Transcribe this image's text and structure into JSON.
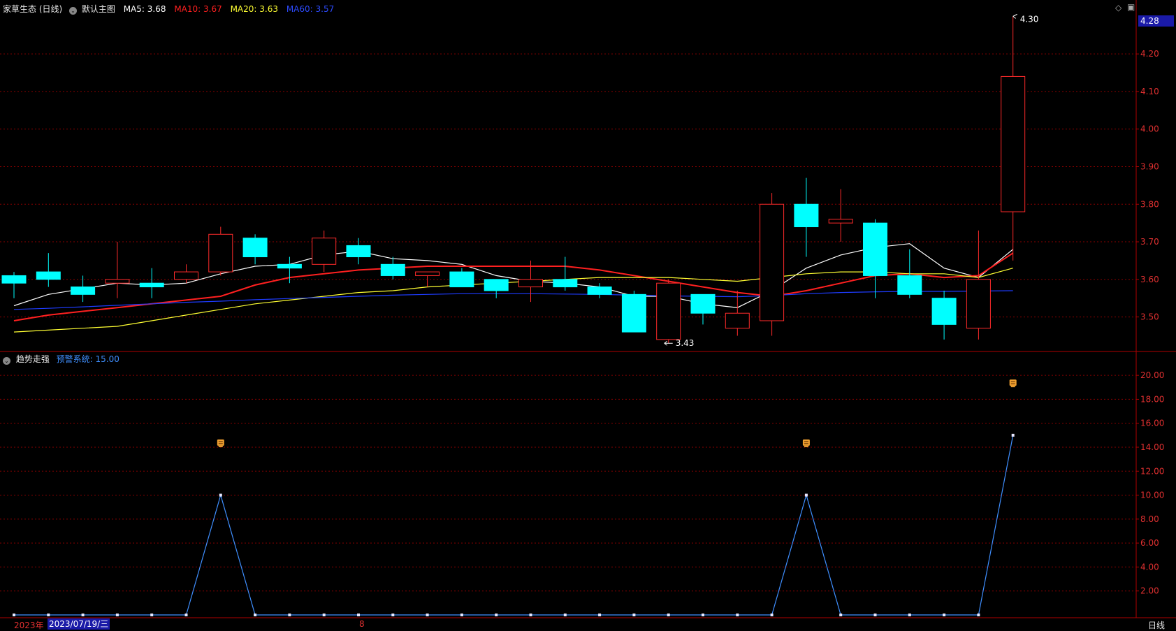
{
  "header": {
    "stock_name": "家草生态 (日线)",
    "main_chart_name": "默认主图",
    "ma5": {
      "label": "MA5:",
      "value": "3.68",
      "color": "#ffffff"
    },
    "ma10": {
      "label": "MA10:",
      "value": "3.67",
      "color": "#ff2020"
    },
    "ma20": {
      "label": "MA20:",
      "value": "3.63",
      "color": "#ffff33"
    },
    "ma60": {
      "label": "MA60:",
      "value": "3.57",
      "color": "#1e3cff"
    }
  },
  "top_right": {
    "diamond": "◇",
    "box": "▣",
    "last_price_tag": "4.28"
  },
  "indicator_header": {
    "name": "趋势走强",
    "series_label": "预警系统:",
    "series_value": "15.00"
  },
  "bottom_bar": {
    "year": "2023年",
    "date": "2023/07/19/三",
    "month_tick": "8",
    "period": "日线"
  },
  "colors": {
    "up": "#ff2b2b",
    "down": "#00ffff",
    "grid": "#8a0000",
    "axis_text": "#e03030",
    "indicator_line": "#3f8fff",
    "signal_icon": "#f0a030"
  },
  "chart_data": [
    {
      "type": "candlestick",
      "title": "",
      "ylim": [
        3.41,
        4.31
      ],
      "y_ticks": [
        3.5,
        3.6,
        3.7,
        3.8,
        3.9,
        4.0,
        4.1,
        4.2
      ],
      "y_tick_labels": [
        "3.50",
        "3.60",
        "3.70",
        "3.80",
        "3.90",
        "4.00",
        "4.10",
        "4.20"
      ],
      "annotations": {
        "high_label": "4.30",
        "low_label": "3.43"
      },
      "candles": [
        {
          "o": 3.61,
          "h": 3.62,
          "l": 3.55,
          "c": 3.59
        },
        {
          "o": 3.62,
          "h": 3.67,
          "l": 3.58,
          "c": 3.6
        },
        {
          "o": 3.58,
          "h": 3.61,
          "l": 3.54,
          "c": 3.56
        },
        {
          "o": 3.59,
          "h": 3.7,
          "l": 3.55,
          "c": 3.6
        },
        {
          "o": 3.59,
          "h": 3.63,
          "l": 3.55,
          "c": 3.58
        },
        {
          "o": 3.6,
          "h": 3.64,
          "l": 3.59,
          "c": 3.62
        },
        {
          "o": 3.62,
          "h": 3.74,
          "l": 3.61,
          "c": 3.72
        },
        {
          "o": 3.71,
          "h": 3.72,
          "l": 3.64,
          "c": 3.66
        },
        {
          "o": 3.64,
          "h": 3.66,
          "l": 3.59,
          "c": 3.63
        },
        {
          "o": 3.64,
          "h": 3.73,
          "l": 3.62,
          "c": 3.71
        },
        {
          "o": 3.69,
          "h": 3.71,
          "l": 3.64,
          "c": 3.66
        },
        {
          "o": 3.64,
          "h": 3.66,
          "l": 3.6,
          "c": 3.61
        },
        {
          "o": 3.61,
          "h": 3.62,
          "l": 3.58,
          "c": 3.62
        },
        {
          "o": 3.62,
          "h": 3.63,
          "l": 3.58,
          "c": 3.58
        },
        {
          "o": 3.6,
          "h": 3.6,
          "l": 3.55,
          "c": 3.57
        },
        {
          "o": 3.58,
          "h": 3.65,
          "l": 3.54,
          "c": 3.6
        },
        {
          "o": 3.6,
          "h": 3.66,
          "l": 3.57,
          "c": 3.58
        },
        {
          "o": 3.58,
          "h": 3.59,
          "l": 3.55,
          "c": 3.56
        },
        {
          "o": 3.56,
          "h": 3.57,
          "l": 3.46,
          "c": 3.46
        },
        {
          "o": 3.44,
          "h": 3.6,
          "l": 3.43,
          "c": 3.59
        },
        {
          "o": 3.56,
          "h": 3.56,
          "l": 3.48,
          "c": 3.51
        },
        {
          "o": 3.47,
          "h": 3.57,
          "l": 3.45,
          "c": 3.51
        },
        {
          "o": 3.49,
          "h": 3.83,
          "l": 3.45,
          "c": 3.8
        },
        {
          "o": 3.8,
          "h": 3.87,
          "l": 3.66,
          "c": 3.74
        },
        {
          "o": 3.75,
          "h": 3.84,
          "l": 3.7,
          "c": 3.76
        },
        {
          "o": 3.75,
          "h": 3.76,
          "l": 3.55,
          "c": 3.61
        },
        {
          "o": 3.61,
          "h": 3.68,
          "l": 3.55,
          "c": 3.56
        },
        {
          "o": 3.55,
          "h": 3.57,
          "l": 3.44,
          "c": 3.48
        },
        {
          "o": 3.47,
          "h": 3.73,
          "l": 3.44,
          "c": 3.6
        },
        {
          "o": 3.78,
          "h": 4.3,
          "l": 3.65,
          "c": 4.14
        }
      ],
      "series": [
        {
          "name": "MA5",
          "values": [
            3.53,
            3.56,
            3.575,
            3.59,
            3.585,
            3.59,
            3.615,
            3.635,
            3.64,
            3.665,
            3.675,
            3.655,
            3.65,
            3.64,
            3.61,
            3.595,
            3.59,
            3.58,
            3.555,
            3.555,
            3.535,
            3.525,
            3.57,
            3.63,
            3.665,
            3.685,
            3.695,
            3.63,
            3.605,
            3.68
          ]
        },
        {
          "name": "MA10",
          "values": [
            3.49,
            3.505,
            3.515,
            3.525,
            3.535,
            3.545,
            3.555,
            3.585,
            3.605,
            3.615,
            3.625,
            3.63,
            3.635,
            3.635,
            3.635,
            3.635,
            3.635,
            3.625,
            3.61,
            3.595,
            3.58,
            3.565,
            3.555,
            3.57,
            3.59,
            3.61,
            3.615,
            3.605,
            3.61,
            3.67
          ]
        },
        {
          "name": "MA20",
          "values": [
            3.46,
            3.465,
            3.47,
            3.475,
            3.49,
            3.505,
            3.52,
            3.535,
            3.545,
            3.555,
            3.565,
            3.57,
            3.58,
            3.585,
            3.59,
            3.595,
            3.6,
            3.605,
            3.605,
            3.605,
            3.6,
            3.595,
            3.605,
            3.615,
            3.62,
            3.62,
            3.615,
            3.615,
            3.605,
            3.63
          ]
        },
        {
          "name": "MA60",
          "values": [
            3.52,
            3.523,
            3.527,
            3.531,
            3.535,
            3.539,
            3.542,
            3.546,
            3.549,
            3.552,
            3.555,
            3.558,
            3.56,
            3.562,
            3.562,
            3.562,
            3.561,
            3.56,
            3.558,
            3.556,
            3.555,
            3.554,
            3.557,
            3.562,
            3.565,
            3.567,
            3.568,
            3.568,
            3.569,
            3.57
          ]
        }
      ]
    },
    {
      "type": "line",
      "title": "",
      "ylim": [
        0,
        21
      ],
      "y_ticks": [
        2,
        4,
        6,
        8,
        10,
        12,
        14,
        16,
        18,
        20
      ],
      "y_tick_labels": [
        "2.00",
        "4.00",
        "6.00",
        "8.00",
        "10.00",
        "12.00",
        "14.00",
        "16.00",
        "18.00",
        "20.00"
      ],
      "series": [
        {
          "name": "预警系统",
          "values": [
            0,
            0,
            0,
            0,
            0,
            0,
            10,
            0,
            0,
            0,
            0,
            0,
            0,
            0,
            0,
            0,
            0,
            0,
            0,
            0,
            0,
            0,
            0,
            10,
            0,
            0,
            0,
            0,
            0,
            15
          ]
        }
      ],
      "signals": [
        {
          "index": 6,
          "level": 14.3
        },
        {
          "index": 23,
          "level": 14.3
        },
        {
          "index": 29,
          "level": 19.3
        }
      ]
    }
  ]
}
